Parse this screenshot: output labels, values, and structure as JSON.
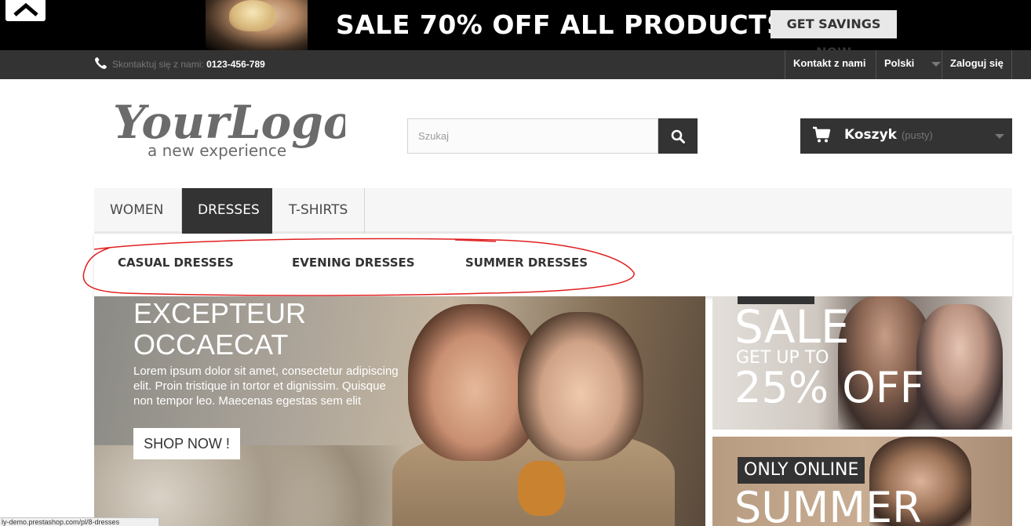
{
  "promo": {
    "headline": "SALE 70% OFF ALL PRODUCTS",
    "cta": "GET SAVINGS NOW"
  },
  "topnav": {
    "contact_label": "Skontaktuj się z nami:",
    "phone": "0123-456-789",
    "contact_link": "Kontakt z nami",
    "language": "Polski",
    "login": "Zaloguj się"
  },
  "header": {
    "logo_main": "YourLogo",
    "logo_tagline": "a new experience",
    "search_placeholder": "Szukaj",
    "cart_label": "Koszyk",
    "cart_status": "(pusty)"
  },
  "menu": {
    "tabs": [
      {
        "label": "WOMEN"
      },
      {
        "label": "DRESSES",
        "active": true
      },
      {
        "label": "T-SHIRTS"
      }
    ],
    "submenu": [
      {
        "label": "CASUAL DRESSES"
      },
      {
        "label": "EVENING DRESSES"
      },
      {
        "label": "SUMMER DRESSES"
      }
    ]
  },
  "hero": {
    "title": "EXCEPTEUR OCCAECAT",
    "description": "Lorem ipsum dolor sit amet, consectetur adipiscing elit. Proin tristique in tortor et dignissim. Quisque non tempor leo. Maecenas egestas sem elit",
    "button": "SHOP NOW !"
  },
  "banner1": {
    "sale": "SALE",
    "get_up_to": "GET UP TO",
    "percent": "25% OFF"
  },
  "banner2": {
    "badge": "ONLY ONLINE",
    "headline": "SUMMER"
  },
  "status_bar": {
    "url": "ly-demo.prestashop.com/pl/8-dresses"
  },
  "colors": {
    "dark": "#333333",
    "annotation": "#e02020"
  }
}
